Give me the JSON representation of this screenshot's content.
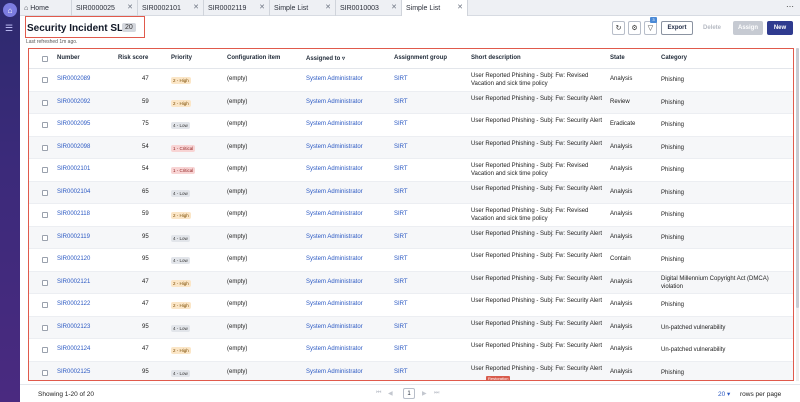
{
  "tabs": [
    {
      "label": "Home"
    },
    {
      "label": "SIR0000025"
    },
    {
      "label": "SIR0002101"
    },
    {
      "label": "SIR0002119"
    },
    {
      "label": "Simple List"
    },
    {
      "label": "SIR0010003"
    },
    {
      "label": "Simple List"
    }
  ],
  "header": {
    "title": "Security Incident SLAs",
    "count": "20",
    "refresh_note": "Last refreshed 1m ago."
  },
  "toolbar": {
    "filter_count": "3",
    "export": "Export",
    "delete": "Delete",
    "assign": "Assign",
    "new": "New"
  },
  "columns": {
    "number": "Number",
    "risk": "Risk score",
    "priority": "Priority",
    "ci": "Configuration item",
    "assigned": "Assigned to",
    "group": "Assignment group",
    "desc": "Short description",
    "state": "State",
    "category": "Category"
  },
  "rows": [
    {
      "number": "SIR0002089",
      "risk": "47",
      "priority": "2 - High",
      "ci": "(empty)",
      "assigned": "System Administrator",
      "group": "SIRT",
      "desc": "User Reported Phishing - Subj: Fw: Revised Vacation and sick time policy",
      "state": "Analysis",
      "category": "Phishing"
    },
    {
      "number": "SIR0002092",
      "risk": "59",
      "priority": "2 - High",
      "ci": "(empty)",
      "assigned": "System Administrator",
      "group": "SIRT",
      "desc": "User Reported Phishing - Subj: Fw: Security Alert",
      "state": "Review",
      "category": "Phishing"
    },
    {
      "number": "SIR0002095",
      "risk": "75",
      "priority": "4 - Low",
      "ci": "(empty)",
      "assigned": "System Administrator",
      "group": "SIRT",
      "desc": "User Reported Phishing - Subj: Fw: Security Alert",
      "state": "Eradicate",
      "category": "Phishing"
    },
    {
      "number": "SIR0002098",
      "risk": "54",
      "priority": "1 - Critical",
      "ci": "(empty)",
      "assigned": "System Administrator",
      "group": "SIRT",
      "desc": "User Reported Phishing - Subj: Fw: Security Alert",
      "state": "Analysis",
      "category": "Phishing"
    },
    {
      "number": "SIR0002101",
      "risk": "54",
      "priority": "1 - Critical",
      "ci": "(empty)",
      "assigned": "System Administrator",
      "group": "SIRT",
      "desc": "User Reported Phishing - Subj: Fw: Revised Vacation and sick time policy",
      "state": "Analysis",
      "category": "Phishing"
    },
    {
      "number": "SIR0002104",
      "risk": "65",
      "priority": "4 - Low",
      "ci": "(empty)",
      "assigned": "System Administrator",
      "group": "SIRT",
      "desc": "User Reported Phishing - Subj: Fw: Security Alert",
      "state": "Analysis",
      "category": "Phishing"
    },
    {
      "number": "SIR0002118",
      "risk": "59",
      "priority": "2 - High",
      "ci": "(empty)",
      "assigned": "System Administrator",
      "group": "SIRT",
      "desc": "User Reported Phishing - Subj: Fw: Revised Vacation and sick time policy",
      "state": "Analysis",
      "category": "Phishing"
    },
    {
      "number": "SIR0002119",
      "risk": "95",
      "priority": "4 - Low",
      "ci": "(empty)",
      "assigned": "System Administrator",
      "group": "SIRT",
      "desc": "User Reported Phishing - Subj: Fw: Security Alert",
      "state": "Analysis",
      "category": "Phishing"
    },
    {
      "number": "SIR0002120",
      "risk": "95",
      "priority": "4 - Low",
      "ci": "(empty)",
      "assigned": "System Administrator",
      "group": "SIRT",
      "desc": "User Reported Phishing - Subj: Fw: Security Alert",
      "state": "Contain",
      "category": "Phishing"
    },
    {
      "number": "SIR0002121",
      "risk": "47",
      "priority": "2 - High",
      "ci": "(empty)",
      "assigned": "System Administrator",
      "group": "SIRT",
      "desc": "User Reported Phishing - Subj: Fw: Security Alert",
      "state": "Analysis",
      "category": "Digital Millennium Copyright Act (DMCA) violation"
    },
    {
      "number": "SIR0002122",
      "risk": "47",
      "priority": "2 - High",
      "ci": "(empty)",
      "assigned": "System Administrator",
      "group": "SIRT",
      "desc": "User Reported Phishing - Subj: Fw: Security Alert",
      "state": "Analysis",
      "category": "Phishing"
    },
    {
      "number": "SIR0002123",
      "risk": "95",
      "priority": "4 - Low",
      "ci": "(empty)",
      "assigned": "System Administrator",
      "group": "SIRT",
      "desc": "User Reported Phishing - Subj: Fw: Security Alert",
      "state": "Analysis",
      "category": "Un-patched vulnerability"
    },
    {
      "number": "SIR0002124",
      "risk": "47",
      "priority": "2 - High",
      "ci": "(empty)",
      "assigned": "System Administrator",
      "group": "SIRT",
      "desc": "User Reported Phishing - Subj: Fw: Security Alert",
      "state": "Analysis",
      "category": "Un-patched vulnerability"
    },
    {
      "number": "SIR0002125",
      "risk": "95",
      "priority": "4 - Low",
      "ci": "(empty)",
      "assigned": "System Administrator",
      "group": "SIRT",
      "desc": "User Reported Phishing - Subj: Fw: Security Alert",
      "state": "Analysis",
      "category": "Phishing"
    }
  ],
  "tooltip": "Restoration",
  "footer": {
    "showing": "Showing 1-20 of 20",
    "page": "1",
    "rows_per_page": "20",
    "rows_label": "rows per page"
  },
  "colors": {
    "accent": "#2f3b8f",
    "link": "#2b59c3",
    "highlight": "#e05a4c"
  }
}
